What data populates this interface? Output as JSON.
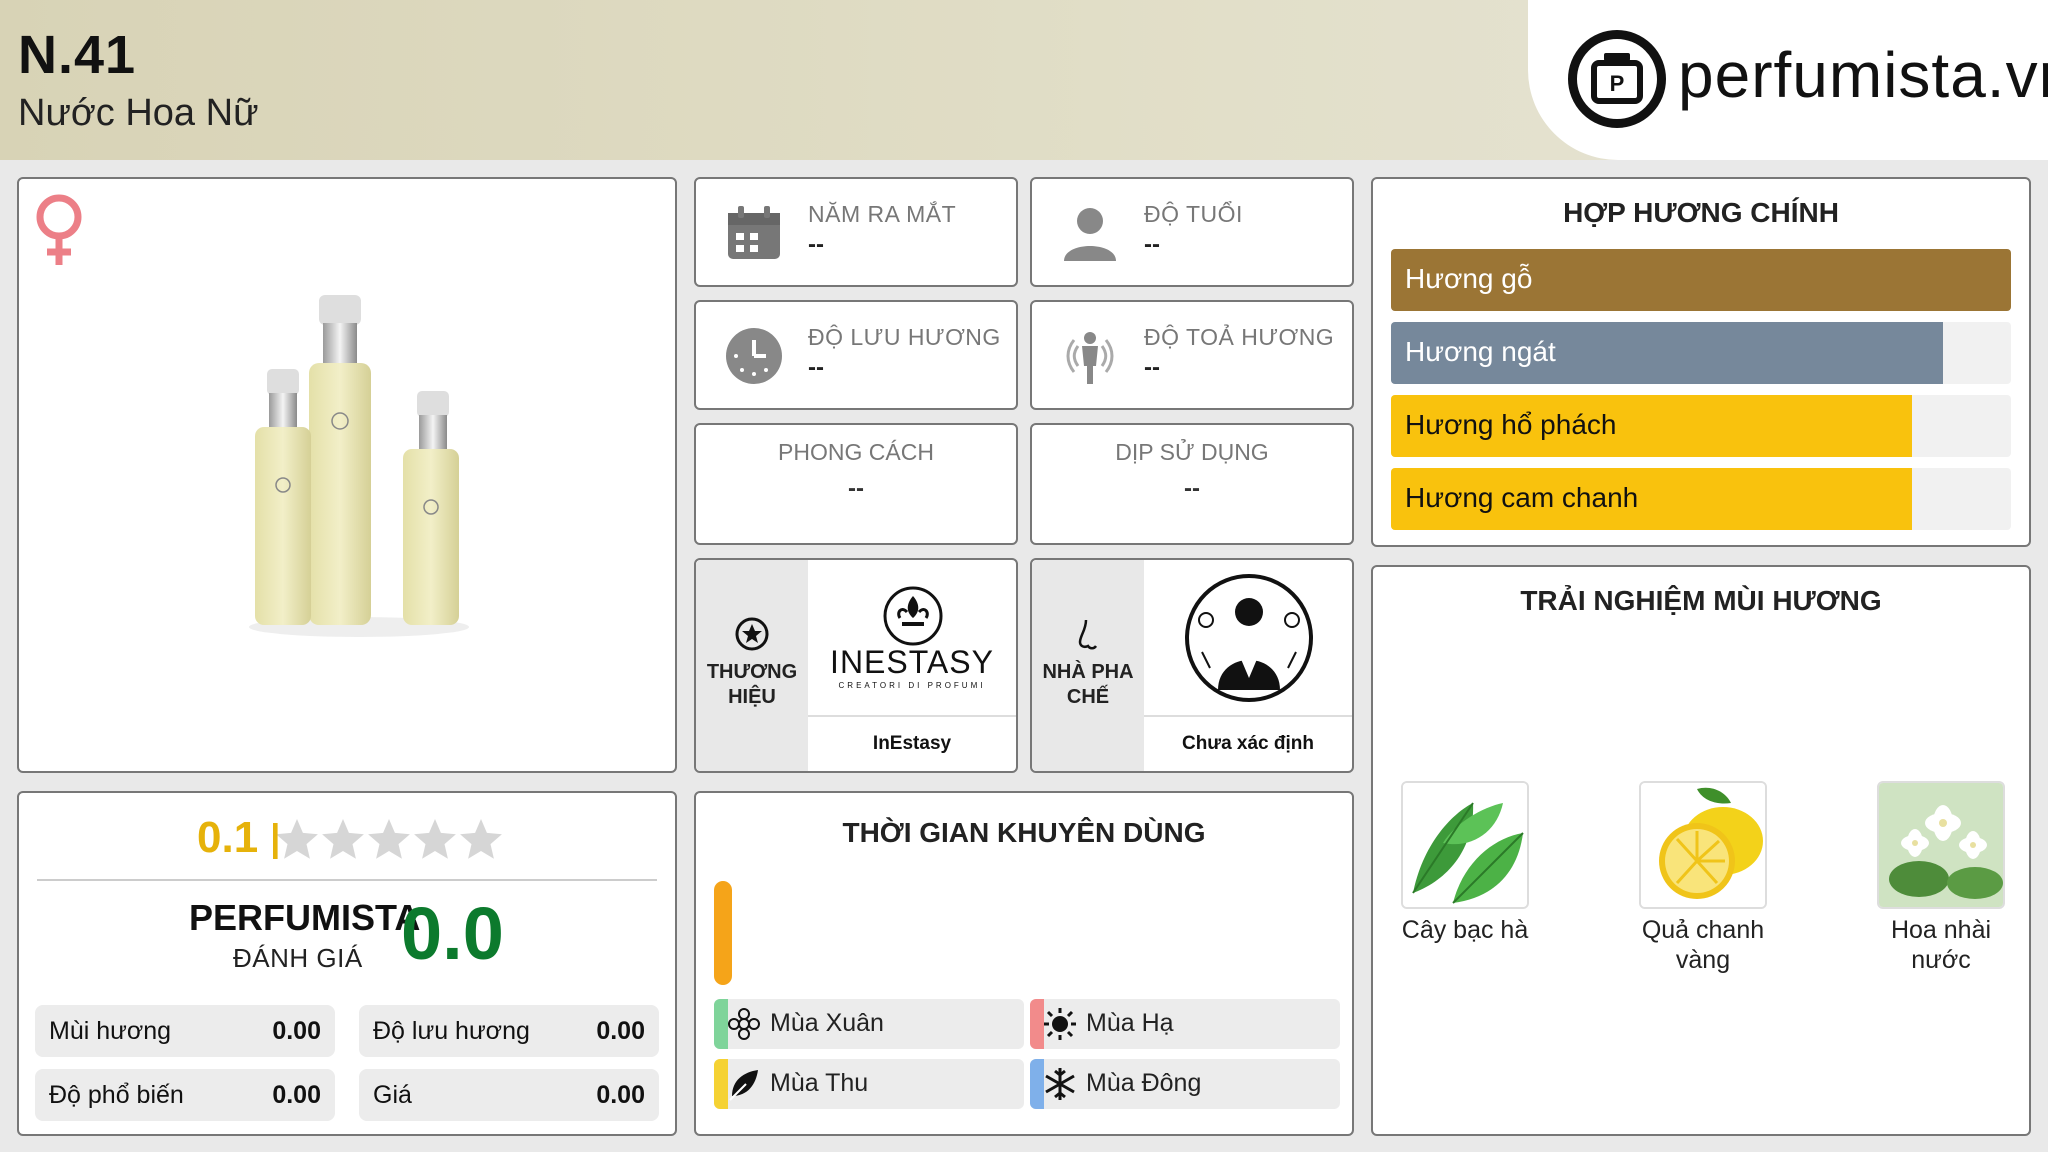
{
  "header": {
    "title": "N.41",
    "subtitle": "Nước Hoa Nữ",
    "logo_text": "perfumista.vn"
  },
  "info": {
    "release_year": {
      "label": "NĂM RA MẮT",
      "value": "--"
    },
    "age": {
      "label": "ĐỘ TUỔI",
      "value": "--"
    },
    "longevity": {
      "label": "ĐỘ LƯU HƯƠNG",
      "value": "--"
    },
    "sillage": {
      "label": "ĐỘ TOẢ HƯƠNG",
      "value": "--"
    },
    "style": {
      "label": "PHONG CÁCH",
      "value": "--"
    },
    "occasion": {
      "label": "DỊP SỬ DỤNG",
      "value": "--"
    }
  },
  "brand": {
    "label": "THƯƠNG HIỆU",
    "logo_text": "INESTASY",
    "logo_sub": "CREATORI DI PROFUMI",
    "name": "InEstasy"
  },
  "perfumer": {
    "label": "NHÀ PHA CHẾ",
    "name": "Chưa xác định"
  },
  "notes": {
    "title": "HỢP HƯƠNG CHÍNH",
    "items": [
      {
        "label": "Hương gỗ",
        "fill": 1.0,
        "color": "#9b7535",
        "text_color": "#ffffff"
      },
      {
        "label": "Hương ngát",
        "fill": 0.89,
        "color": "#76889b",
        "text_color": "#ffffff"
      },
      {
        "label": "Hương hổ phách",
        "fill": 0.84,
        "color": "#f9c20d",
        "text_color": "#111111"
      },
      {
        "label": "Hương cam chanh",
        "fill": 0.84,
        "color": "#f9c20d",
        "text_color": "#111111"
      }
    ]
  },
  "rating": {
    "score": "0.1",
    "stars_filled": 0.02,
    "perfumista_label": "PERFUMISTA",
    "perfumista_sub": "ĐÁNH GIÁ",
    "perfumista_score": "0.0",
    "scores": [
      {
        "label": "Mùi hương",
        "value": "0.00"
      },
      {
        "label": "Độ lưu hương",
        "value": "0.00"
      },
      {
        "label": "Độ phổ biến",
        "value": "0.00"
      },
      {
        "label": "Giá",
        "value": "0.00"
      }
    ]
  },
  "seasons": {
    "title": "THỜI GIAN KHUYÊN DÙNG",
    "items": [
      {
        "label": "Mùa Xuân",
        "icon": "flower-icon",
        "color": "#7fd49a"
      },
      {
        "label": "Mùa Hạ",
        "icon": "sun-icon",
        "color": "#f28b8b"
      },
      {
        "label": "Mùa Thu",
        "icon": "leaf-icon",
        "color": "#f5d233"
      },
      {
        "label": "Mùa Đông",
        "icon": "snowflake-icon",
        "color": "#7fb0ea"
      }
    ]
  },
  "experience": {
    "title": "TRẢI NGHIỆM MÙI HƯƠNG",
    "items": [
      {
        "label": "Cây bạc hà",
        "icon": "mint-image"
      },
      {
        "label": "Quả chanh vàng",
        "icon": "lemon-image"
      },
      {
        "label": "Hoa nhài nước",
        "icon": "jasmine-image"
      }
    ]
  }
}
